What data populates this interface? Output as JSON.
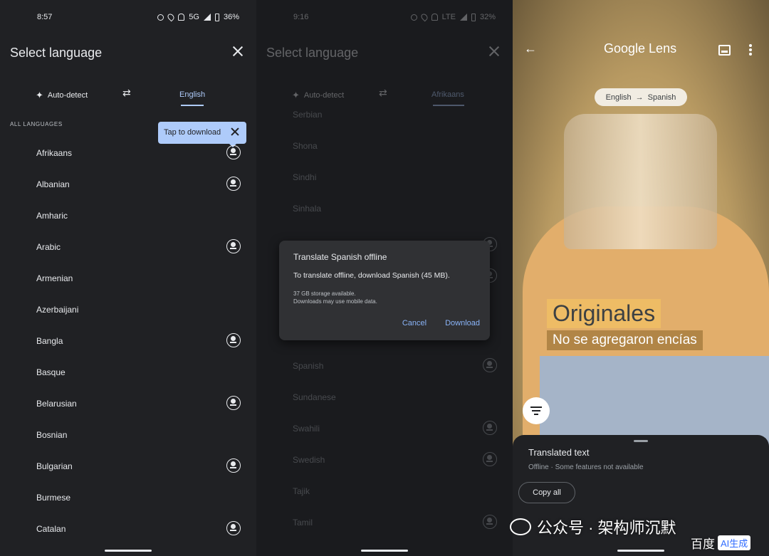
{
  "panel1": {
    "status": {
      "time": "8:57",
      "network": "5G",
      "battery": "36%"
    },
    "title": "Select language",
    "tabs": {
      "auto": "Auto-detect",
      "selected": "English"
    },
    "section_label": "ALL LANGUAGES",
    "tooltip": "Tap to download",
    "languages": [
      {
        "name": "Afrikaans",
        "download": true
      },
      {
        "name": "Albanian",
        "download": true
      },
      {
        "name": "Amharic",
        "download": false
      },
      {
        "name": "Arabic",
        "download": true
      },
      {
        "name": "Armenian",
        "download": false
      },
      {
        "name": "Azerbaijani",
        "download": false
      },
      {
        "name": "Bangla",
        "download": true
      },
      {
        "name": "Basque",
        "download": false
      },
      {
        "name": "Belarusian",
        "download": true
      },
      {
        "name": "Bosnian",
        "download": false
      },
      {
        "name": "Bulgarian",
        "download": true
      },
      {
        "name": "Burmese",
        "download": false
      },
      {
        "name": "Catalan",
        "download": true
      }
    ]
  },
  "panel2": {
    "status": {
      "time": "9:16",
      "network": "LTE",
      "battery": "32%"
    },
    "title": "Select language",
    "tabs": {
      "auto": "Auto-detect",
      "selected": "Afrikaans"
    },
    "languages_top": [
      "Serbian",
      "Shona",
      "Sindhi",
      "Sinhala"
    ],
    "languages_bottom": [
      {
        "name": "Spanish",
        "download": true
      },
      {
        "name": "Sundanese",
        "download": false
      },
      {
        "name": "Swahili",
        "download": true
      },
      {
        "name": "Swedish",
        "download": true
      },
      {
        "name": "Tajik",
        "download": false
      },
      {
        "name": "Tamil",
        "download": true
      }
    ],
    "dialog": {
      "title": "Translate Spanish offline",
      "body": "To translate offline, download Spanish (45 MB).",
      "note1": "37 GB storage available.",
      "note2": "Downloads may use mobile data.",
      "cancel": "Cancel",
      "download": "Download"
    }
  },
  "panel3": {
    "title": "Google Lens",
    "pill": {
      "from": "English",
      "arrow": "→",
      "to": "Spanish"
    },
    "overlay_line1": "Originales",
    "overlay_line2": "No se agregaron encías",
    "sheet": {
      "title": "Translated text",
      "subtitle": "Offline · Some features not available",
      "copy_all": "Copy all"
    }
  },
  "watermark": {
    "text": "公众号 · 架构师沉默",
    "brand": "百度",
    "badge": "AI生成"
  }
}
